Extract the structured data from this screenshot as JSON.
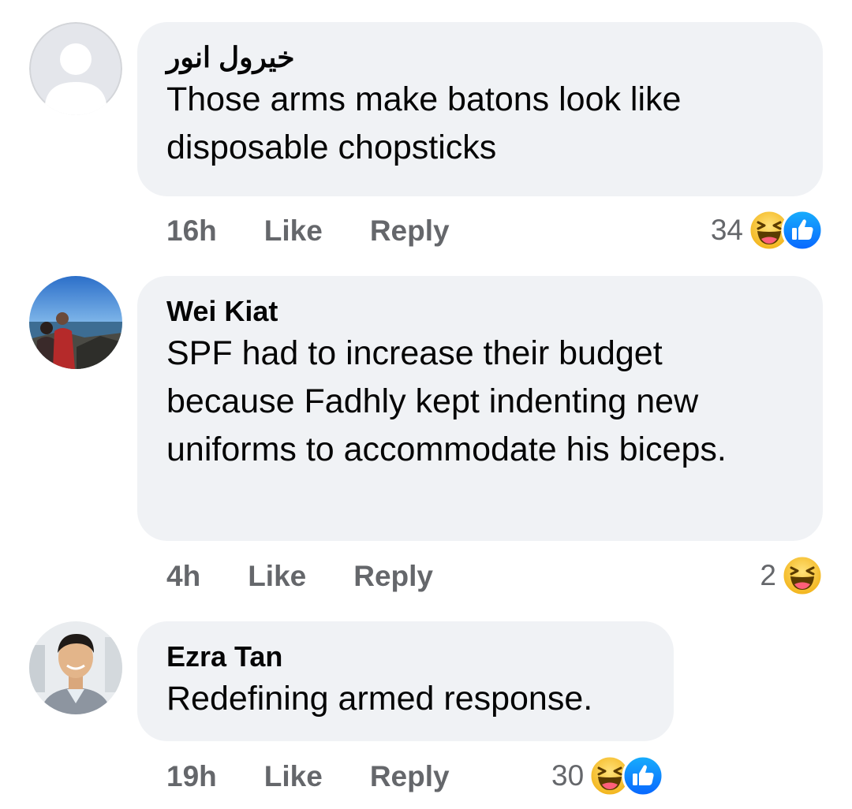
{
  "comments": [
    {
      "author": "خيرول انور",
      "text": "Those arms make batons look like disposable chopsticks",
      "time": "16h",
      "like_label": "Like",
      "reply_label": "Reply",
      "reaction_count": "34",
      "reactions": [
        "haha-emoji-icon",
        "like-thumb-icon"
      ]
    },
    {
      "author": "Wei Kiat",
      "text": "SPF had to increase their budget because Fadhly kept indenting new uniforms to accommodate his biceps.",
      "time": "4h",
      "like_label": "Like",
      "reply_label": "Reply",
      "reaction_count": "2",
      "reactions": [
        "haha-emoji-icon"
      ]
    },
    {
      "author": "Ezra Tan",
      "text": "Redefining armed response.",
      "time": "19h",
      "like_label": "Like",
      "reply_label": "Reply",
      "reaction_count": "30",
      "reactions": [
        "haha-emoji-icon",
        "like-thumb-icon"
      ]
    }
  ],
  "colors": {
    "bubble": "#f0f2f5",
    "meta_text": "#65676b",
    "like_blue": "#1877f2",
    "haha_yellow": "#f7c233"
  }
}
